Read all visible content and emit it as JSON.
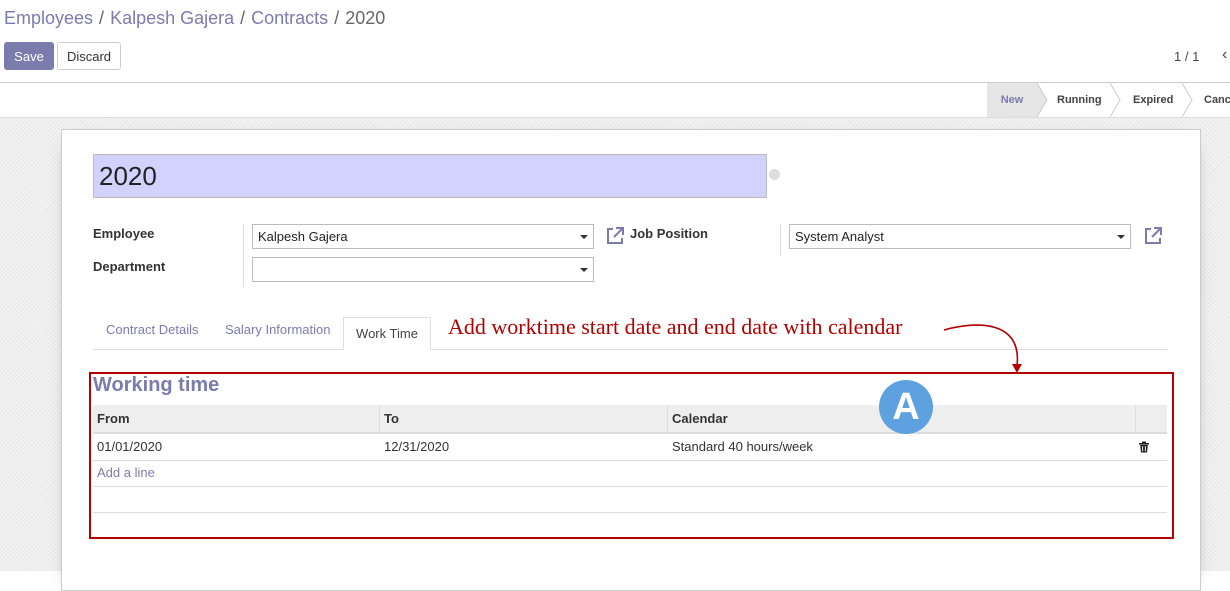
{
  "breadcrumb": {
    "items": [
      "Employees",
      "Kalpesh Gajera",
      "Contracts"
    ],
    "current": "2020",
    "separator": "/"
  },
  "toolbar": {
    "save_label": "Save",
    "discard_label": "Discard"
  },
  "pager": {
    "value": "1 / 1"
  },
  "statusbar": {
    "stages": [
      "New",
      "Running",
      "Expired",
      "Canc"
    ],
    "active": "New"
  },
  "form": {
    "name": "2020",
    "employee_label": "Employee",
    "employee_value": "Kalpesh Gajera",
    "department_label": "Department",
    "department_value": "",
    "job_position_label": "Job Position",
    "job_position_value": "System Analyst"
  },
  "tabs": [
    {
      "label": "Contract Details"
    },
    {
      "label": "Salary Information"
    },
    {
      "label": "Work Time",
      "active": true
    }
  ],
  "annotation": {
    "text": "Add worktime start date and end date with calendar",
    "badge": "A",
    "color": "#b30000"
  },
  "working_time": {
    "title": "Working time",
    "columns": [
      "From",
      "To",
      "Calendar"
    ],
    "rows": [
      {
        "from": "01/01/2020",
        "to": "12/31/2020",
        "calendar": "Standard 40 hours/week"
      }
    ],
    "add_line_label": "Add a line"
  },
  "colors": {
    "brand": "#7c7bad",
    "name_field_bg": "#d2d2ff",
    "badge": "#5ea1e0"
  },
  "icons": [
    "external-link-icon",
    "trash-icon",
    "dropdown-caret-icon",
    "chevron-left-icon"
  ]
}
